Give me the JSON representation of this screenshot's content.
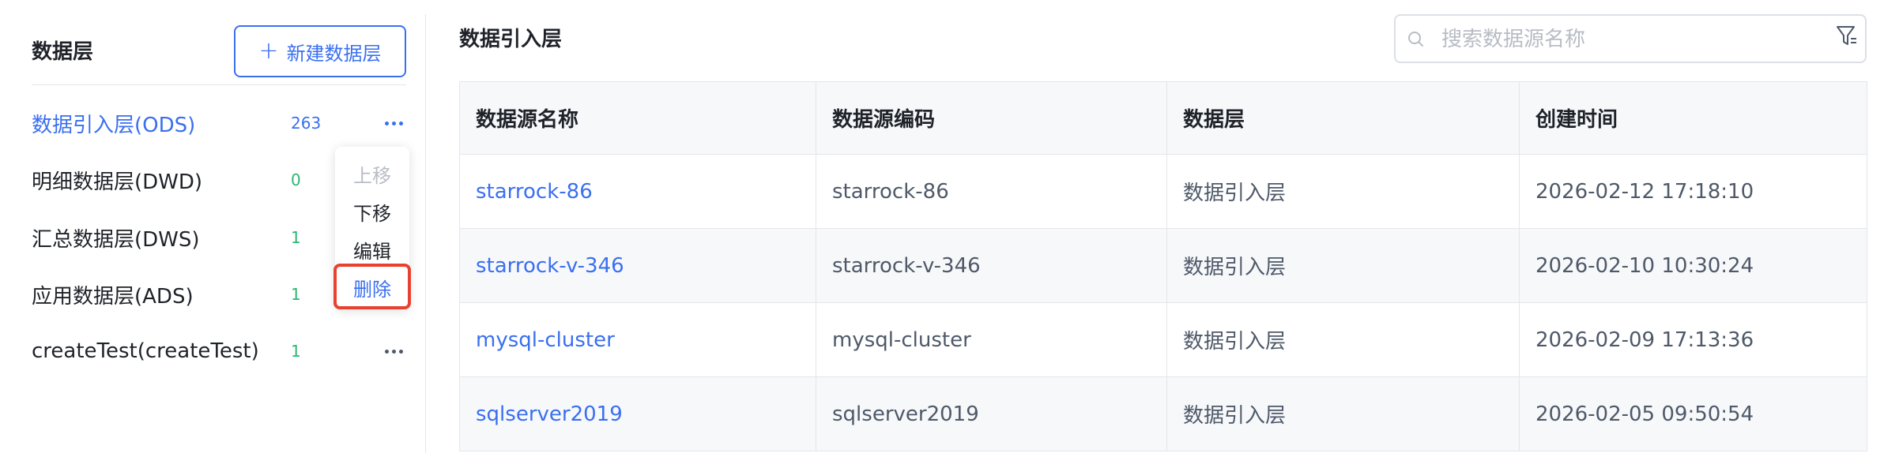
{
  "sidebar": {
    "title": "数据层",
    "new_button_label": "新建数据层",
    "new_button_icon": "+",
    "items": [
      {
        "label": "数据引入层(ODS)",
        "count": "263"
      },
      {
        "label": "明细数据层(DWD)",
        "count": "0"
      },
      {
        "label": "汇总数据层(DWS)",
        "count": "1"
      },
      {
        "label": "应用数据层(ADS)",
        "count": "1"
      },
      {
        "label": "createTest(createTest)",
        "count": "1"
      }
    ]
  },
  "context_menu": {
    "move_up": "上移",
    "move_down": "下移",
    "edit": "编辑",
    "delete": "删除"
  },
  "main": {
    "title": "数据引入层",
    "search": {
      "placeholder": "搜索数据源名称"
    },
    "table": {
      "columns": [
        "数据源名称",
        "数据源编码",
        "数据层",
        "创建时间"
      ],
      "rows": [
        [
          "starrock-86",
          "starrock-86",
          "数据引入层",
          "2026-02-12 17:18:10"
        ],
        [
          "starrock-v-346",
          "starrock-v-346",
          "数据引入层",
          "2026-02-10 10:30:24"
        ],
        [
          "mysql-cluster",
          "mysql-cluster",
          "数据引入层",
          "2026-02-09 17:13:36"
        ],
        [
          "sqlserver2019",
          "sqlserver2019",
          "数据引入层",
          "2026-02-05 09:50:54"
        ]
      ]
    }
  },
  "colors": {
    "accent": "#3a6ff0",
    "count_green": "#2bb673",
    "highlight_red": "#e8412f"
  }
}
